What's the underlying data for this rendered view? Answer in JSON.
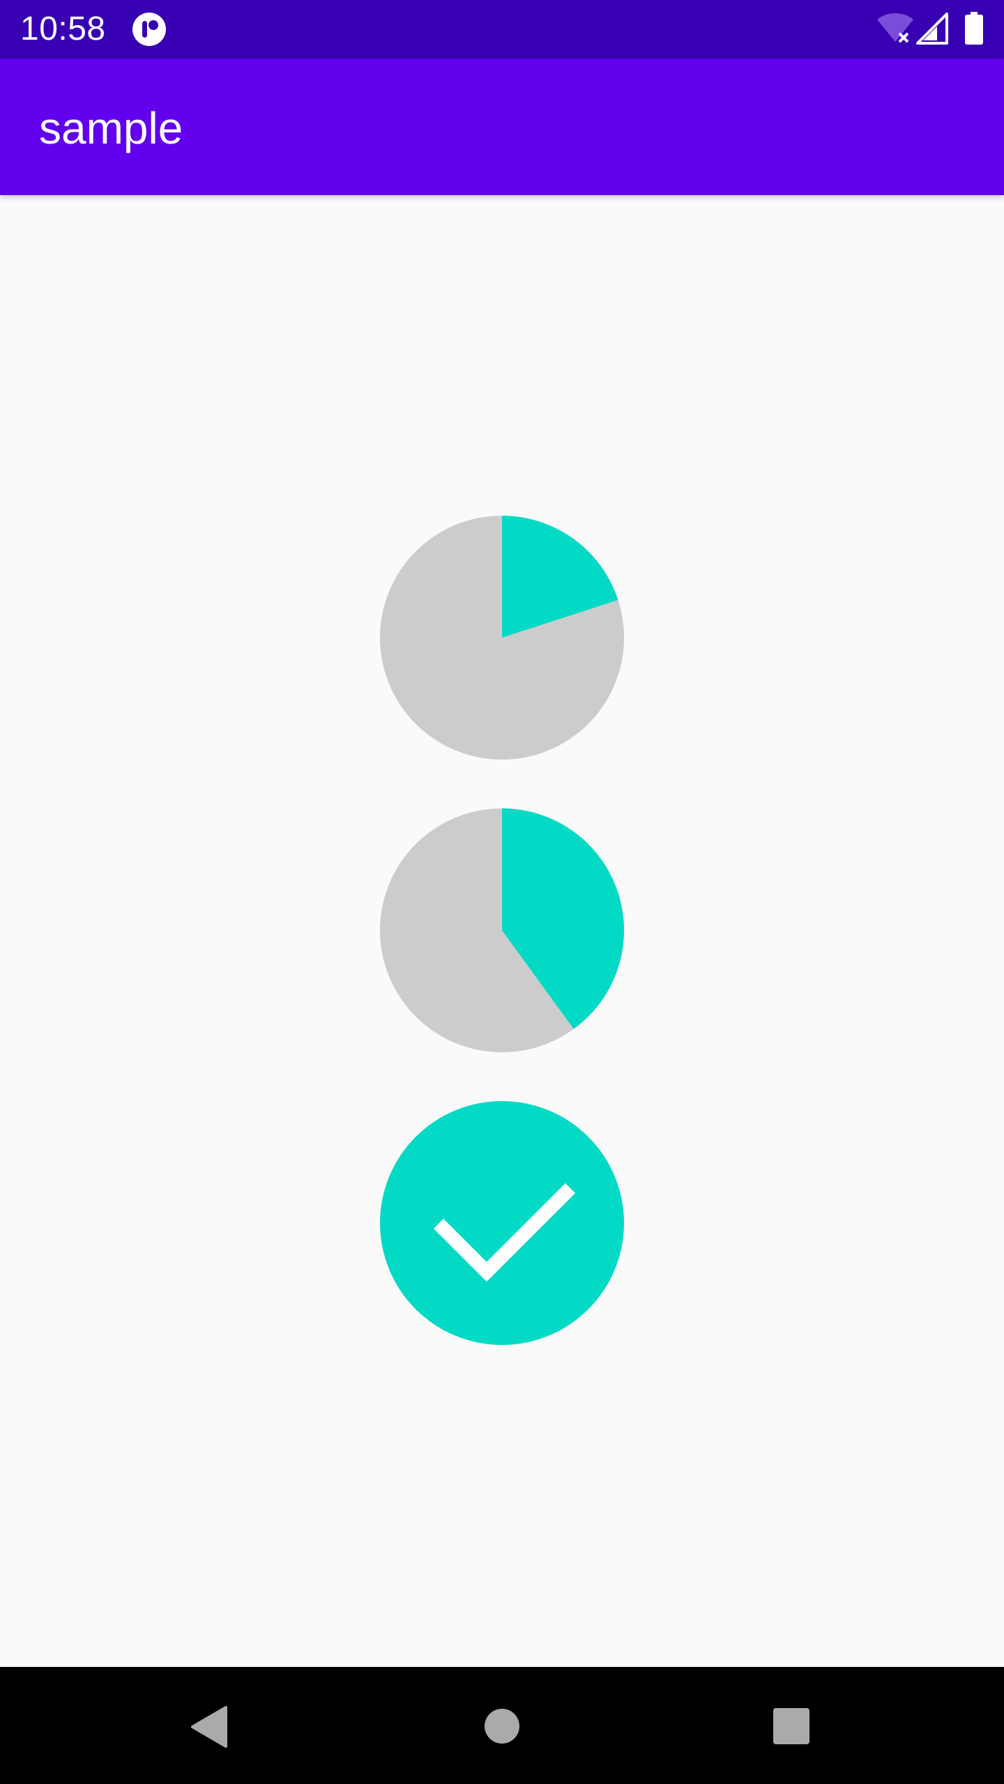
{
  "status_bar": {
    "time": "10:58",
    "icons": [
      "app-notification-icon",
      "wifi-off-icon",
      "cell-signal-icon",
      "battery-icon"
    ]
  },
  "app_bar": {
    "title": "sample"
  },
  "progress_pies": [
    {
      "progress": 0.2,
      "color": "#03dac5",
      "track_color": "#cccccc"
    },
    {
      "progress": 0.4,
      "color": "#03dac5",
      "track_color": "#cccccc"
    },
    {
      "progress": 1.0,
      "complete": true,
      "color": "#03dac5",
      "icon": "check-icon"
    }
  ],
  "colors": {
    "status_bar": "#3700b3",
    "app_bar": "#6200ee",
    "accent": "#03dac5",
    "track": "#cccccc",
    "background": "#fafafa",
    "nav_bar": "#000000",
    "nav_icons": "#aaaaaa"
  },
  "nav_bar": {
    "icons": [
      "back-icon",
      "home-icon",
      "recents-icon"
    ]
  }
}
